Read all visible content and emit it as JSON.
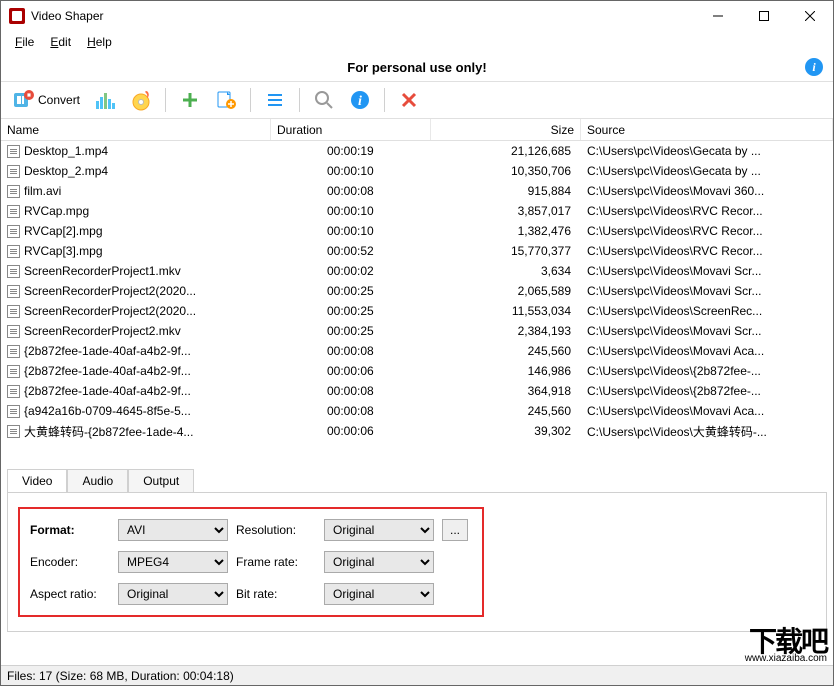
{
  "title": "Video Shaper",
  "menu": {
    "file": "File",
    "edit": "Edit",
    "help": "Help"
  },
  "banner_text": "For personal use only!",
  "toolbar": {
    "convert": "Convert"
  },
  "columns": {
    "name": "Name",
    "duration": "Duration",
    "size": "Size",
    "source": "Source"
  },
  "files": [
    {
      "name": "Desktop_1.mp4",
      "duration": "00:00:19",
      "size": "21,126,685",
      "source": "C:\\Users\\pc\\Videos\\Gecata by ..."
    },
    {
      "name": "Desktop_2.mp4",
      "duration": "00:00:10",
      "size": "10,350,706",
      "source": "C:\\Users\\pc\\Videos\\Gecata by ..."
    },
    {
      "name": "film.avi",
      "duration": "00:00:08",
      "size": "915,884",
      "source": "C:\\Users\\pc\\Videos\\Movavi 360..."
    },
    {
      "name": "RVCap.mpg",
      "duration": "00:00:10",
      "size": "3,857,017",
      "source": "C:\\Users\\pc\\Videos\\RVC Recor..."
    },
    {
      "name": "RVCap[2].mpg",
      "duration": "00:00:10",
      "size": "1,382,476",
      "source": "C:\\Users\\pc\\Videos\\RVC Recor..."
    },
    {
      "name": "RVCap[3].mpg",
      "duration": "00:00:52",
      "size": "15,770,377",
      "source": "C:\\Users\\pc\\Videos\\RVC Recor..."
    },
    {
      "name": "ScreenRecorderProject1.mkv",
      "duration": "00:00:02",
      "size": "3,634",
      "source": "C:\\Users\\pc\\Videos\\Movavi Scr..."
    },
    {
      "name": "ScreenRecorderProject2(2020...",
      "duration": "00:00:25",
      "size": "2,065,589",
      "source": "C:\\Users\\pc\\Videos\\Movavi Scr..."
    },
    {
      "name": "ScreenRecorderProject2(2020...",
      "duration": "00:00:25",
      "size": "11,553,034",
      "source": "C:\\Users\\pc\\Videos\\ScreenRec..."
    },
    {
      "name": "ScreenRecorderProject2.mkv",
      "duration": "00:00:25",
      "size": "2,384,193",
      "source": "C:\\Users\\pc\\Videos\\Movavi Scr..."
    },
    {
      "name": "{2b872fee-1ade-40af-a4b2-9f...",
      "duration": "00:00:08",
      "size": "245,560",
      "source": "C:\\Users\\pc\\Videos\\Movavi Aca..."
    },
    {
      "name": "{2b872fee-1ade-40af-a4b2-9f...",
      "duration": "00:00:06",
      "size": "146,986",
      "source": "C:\\Users\\pc\\Videos\\{2b872fee-..."
    },
    {
      "name": "{2b872fee-1ade-40af-a4b2-9f...",
      "duration": "00:00:08",
      "size": "364,918",
      "source": "C:\\Users\\pc\\Videos\\{2b872fee-..."
    },
    {
      "name": "{a942a16b-0709-4645-8f5e-5...",
      "duration": "00:00:08",
      "size": "245,560",
      "source": "C:\\Users\\pc\\Videos\\Movavi Aca..."
    },
    {
      "name": "大黄蜂转码-{2b872fee-1ade-4...",
      "duration": "00:00:06",
      "size": "39,302",
      "source": "C:\\Users\\pc\\Videos\\大黄蜂转码-..."
    }
  ],
  "tabs": {
    "video": "Video",
    "audio": "Audio",
    "output": "Output"
  },
  "video_panel": {
    "format_label": "Format:",
    "format_value": "AVI",
    "encoder_label": "Encoder:",
    "encoder_value": "MPEG4",
    "aspect_label": "Aspect ratio:",
    "aspect_value": "Original",
    "resolution_label": "Resolution:",
    "resolution_value": "Original",
    "framerate_label": "Frame rate:",
    "framerate_value": "Original",
    "bitrate_label": "Bit rate:",
    "bitrate_value": "Original",
    "browse": "..."
  },
  "status": "Files: 17 (Size: 68 MB, Duration: 00:04:18)",
  "watermark": {
    "main": "下载吧",
    "sub": "www.xiazaiba.com"
  }
}
